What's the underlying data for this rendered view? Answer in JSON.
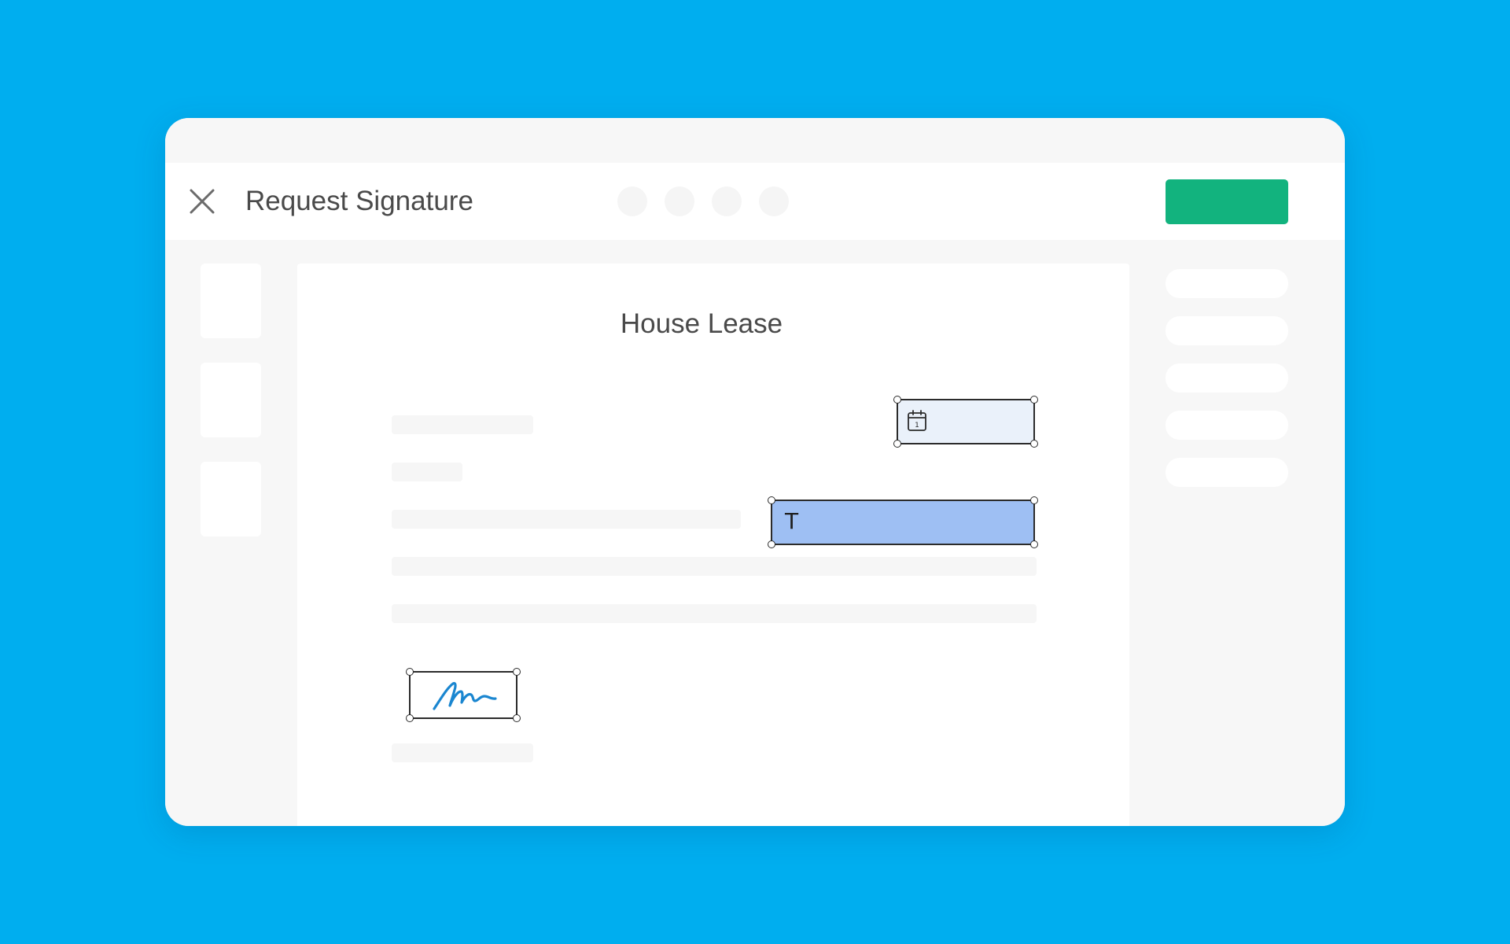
{
  "header": {
    "title": "Request Signature",
    "close_icon": "close-icon",
    "send_button_label": "",
    "send_button_color": "#12b37e",
    "step_dots_count": 4
  },
  "document": {
    "title": "House Lease",
    "fields": {
      "date": {
        "icon": "calendar-icon",
        "day": "1",
        "color": "#eaf1fa"
      },
      "text": {
        "icon_glyph": "T",
        "color": "#9ebff3"
      },
      "signature": {
        "icon": "signature-icon",
        "stroke_color": "#1a86d0"
      }
    }
  },
  "sidebar": {
    "page_thumbnails_count": 3
  },
  "right_panel": {
    "items_count": 5
  },
  "colors": {
    "background": "#00aeef",
    "window": "#f7f7f7",
    "header": "#ffffff"
  }
}
